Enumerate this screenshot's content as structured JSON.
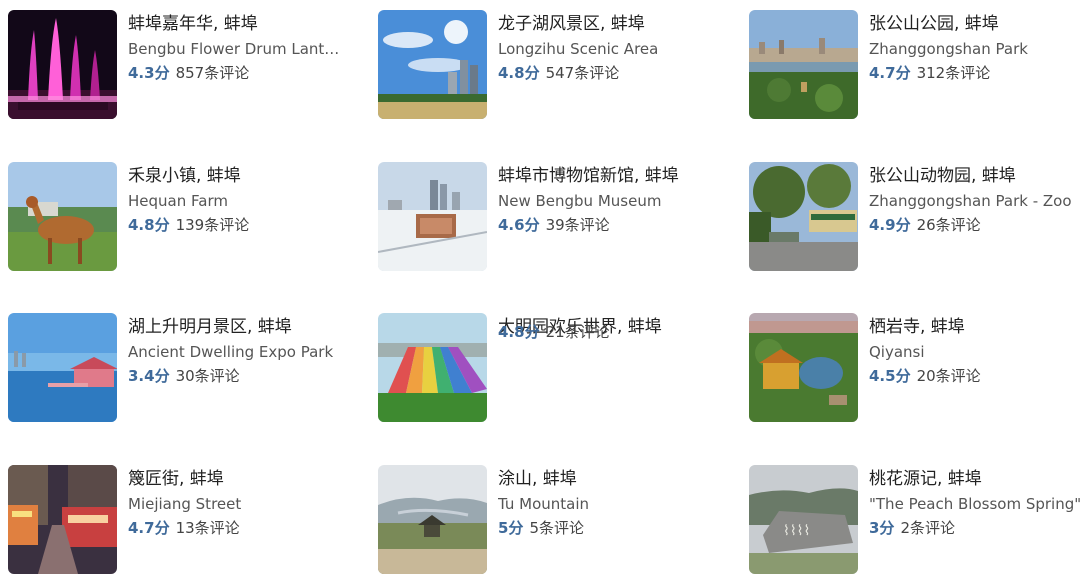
{
  "places": [
    {
      "title": "蚌埠嘉年华, 蚌埠",
      "subtitle": "Bengbu Flower Drum Lante...",
      "score": "4.3分",
      "reviews": "857条评论",
      "thumb": "fountain-photo"
    },
    {
      "title": "龙子湖风景区, 蚌埠",
      "subtitle": "Longzihu Scenic Area",
      "score": "4.8分",
      "reviews": "547条评论",
      "thumb": "lake-skyline-photo"
    },
    {
      "title": "张公山公园, 蚌埠",
      "subtitle": "Zhanggongshan Park",
      "score": "4.7分",
      "reviews": "312条评论",
      "thumb": "park-aerial-photo"
    },
    {
      "title": "禾泉小镇, 蚌埠",
      "subtitle": "Hequan Farm",
      "score": "4.8分",
      "reviews": "139条评论",
      "thumb": "deer-photo"
    },
    {
      "title": "蚌埠市博物馆新馆, 蚌埠",
      "subtitle": "New Bengbu Museum",
      "score": "4.6分",
      "reviews": "39条评论",
      "thumb": "museum-snow-photo"
    },
    {
      "title": "张公山动物园, 蚌埠",
      "subtitle": "Zhanggongshan Park - Zoo",
      "score": "4.9分",
      "reviews": "26条评论",
      "thumb": "zoo-gate-photo"
    },
    {
      "title": "湖上升明月景区, 蚌埠",
      "subtitle": "Ancient Dwelling Expo Park",
      "score": "3.4分",
      "reviews": "30条评论",
      "thumb": "lake-pavilion-photo"
    },
    {
      "title": "大明园欢乐世界, 蚌埠",
      "subtitle": "",
      "score": "4.8分",
      "reviews": "21条评论",
      "thumb": "rainbow-slide-photo"
    },
    {
      "title": "栖岩寺, 蚌埠",
      "subtitle": "Qiyansi",
      "score": "4.5分",
      "reviews": "20条评论",
      "thumb": "temple-aerial-photo"
    },
    {
      "title": "篾匠街, 蚌埠",
      "subtitle": "Miejiang Street",
      "score": "4.7分",
      "reviews": "13条评论",
      "thumb": "street-night-photo"
    },
    {
      "title": "涂山, 蚌埠",
      "subtitle": "Tu Mountain",
      "score": "5分",
      "reviews": "5条评论",
      "thumb": "mountain-pavilion-photo"
    },
    {
      "title": "桃花源记, 蚌埠",
      "subtitle": "\"The Peach Blossom Spring\"",
      "score": "3分",
      "reviews": "2条评论",
      "thumb": "stone-sign-photo"
    }
  ],
  "colors": {
    "score": "#3f6a9a",
    "title": "#222222",
    "subtitle": "#555555"
  }
}
